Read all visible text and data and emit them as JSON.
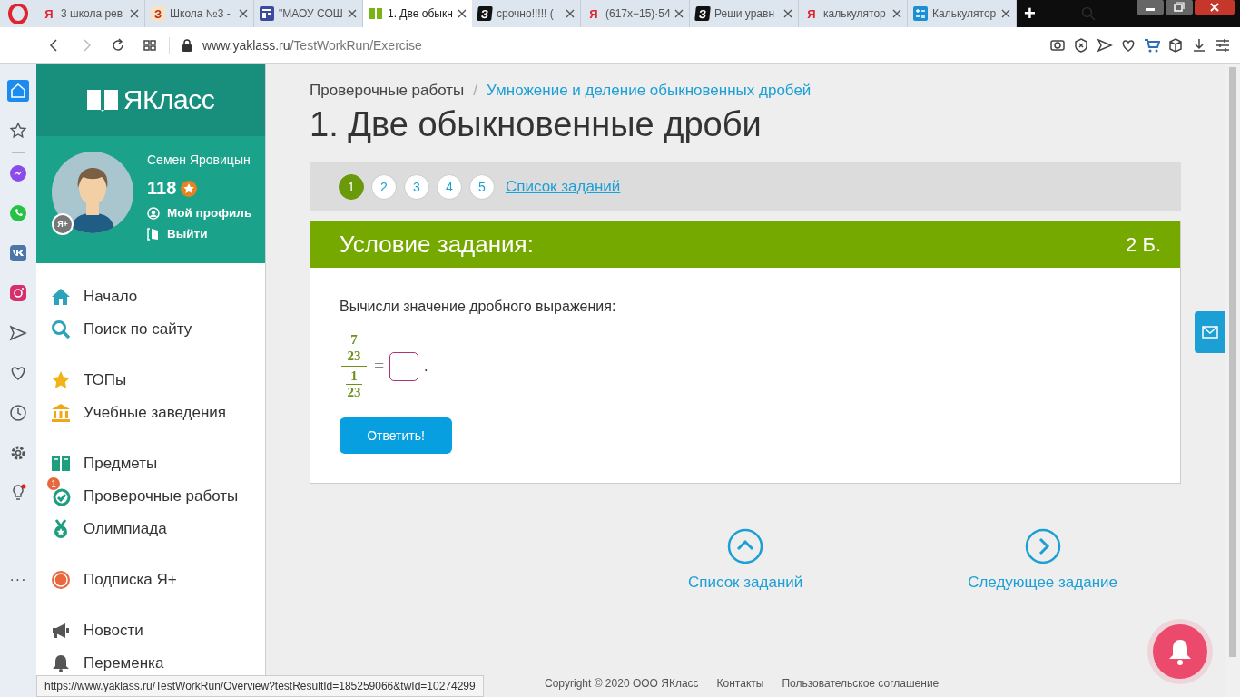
{
  "browser": {
    "tabs": [
      {
        "title": "3 школа рев",
        "kind": "yandex",
        "icon_letter": "Я",
        "selected": false
      },
      {
        "title": "Школа №3 -",
        "kind": "orange-letter",
        "icon_letter": "З",
        "selected": false
      },
      {
        "title": "\"МАОУ СОШ",
        "kind": "site",
        "selected": false
      },
      {
        "title": "1. Две обыкн",
        "kind": "book",
        "selected": true
      },
      {
        "title": "срочно!!!!! (",
        "kind": "black-letter",
        "icon_letter": "З",
        "selected": false
      },
      {
        "title": "(617x−15)·54",
        "kind": "yandex",
        "icon_letter": "Я",
        "selected": false
      },
      {
        "title": "Реши уравн",
        "kind": "black-letter",
        "icon_letter": "З",
        "selected": false
      },
      {
        "title": "калькулятор",
        "kind": "yandex",
        "icon_letter": "Я",
        "selected": false
      },
      {
        "title": "Калькулятор",
        "kind": "calc",
        "selected": false
      }
    ],
    "new_tab": "+",
    "url": {
      "host": "www.yaklass.ru",
      "path": "/TestWorkRun/Exercise"
    },
    "side_icons": [
      {
        "kind": "home",
        "selected": true
      },
      {
        "kind": "star",
        "selected": false
      },
      {
        "kind": "messenger",
        "selected": false
      },
      {
        "kind": "whatsapp",
        "selected": false
      },
      {
        "kind": "vk",
        "selected": false
      },
      {
        "kind": "instagram",
        "selected": false
      },
      {
        "kind": "send",
        "selected": false
      },
      {
        "kind": "heart",
        "selected": false
      },
      {
        "kind": "clock",
        "selected": false
      },
      {
        "kind": "settings",
        "selected": false
      },
      {
        "kind": "bulb",
        "selected": false
      }
    ],
    "more": "···",
    "status_url": "https://www.yaklass.ru/TestWorkRun/Overview?testResultId=185259066&twId=10274299"
  },
  "site": {
    "logo": "ЯКласс",
    "profile": {
      "name": "Семен Яровицын",
      "points": "118",
      "badge": "Я+",
      "links": [
        {
          "kind": "user",
          "label": "Мой профиль"
        },
        {
          "kind": "exit",
          "label": "Выйти"
        }
      ]
    },
    "nav": [
      [
        {
          "kind": "home",
          "label": "Начало"
        },
        {
          "kind": "search",
          "label": "Поиск по сайту"
        }
      ],
      [
        {
          "kind": "star",
          "label": "ТОПы"
        },
        {
          "kind": "school",
          "label": "Учебные заведения"
        }
      ],
      [
        {
          "kind": "book",
          "label": "Предметы"
        },
        {
          "kind": "check",
          "label": "Проверочные работы",
          "count": "1"
        },
        {
          "kind": "medal",
          "label": "Олимпиада"
        }
      ],
      [
        {
          "kind": "plus",
          "label": "Подписка Я+"
        }
      ],
      [
        {
          "kind": "news",
          "label": "Новости"
        },
        {
          "kind": "bell",
          "label": "Переменка"
        }
      ]
    ],
    "breadcrumb": {
      "items": [
        "Проверочные работы",
        "Умножение и деление обыкновенных дробей"
      ],
      "separator": "/"
    },
    "title": "1. Две обыкновенные дроби",
    "pager": {
      "pages": [
        {
          "label": "1",
          "selected": true
        },
        {
          "label": "2",
          "selected": false
        },
        {
          "label": "3",
          "selected": false
        },
        {
          "label": "4",
          "selected": false
        },
        {
          "label": "5",
          "selected": false
        }
      ],
      "list_link": "Список заданий"
    },
    "task": {
      "heading": "Условие задания:",
      "score": "2 Б.",
      "question": "Вычисли значение дробного выражения:",
      "expression": {
        "top": {
          "num": "7",
          "den": "23"
        },
        "bottom": {
          "num": "1",
          "den": "23"
        },
        "equals": "=",
        "end": "."
      },
      "answer_button": "Ответить!"
    },
    "bottom_nav": [
      {
        "kind": "up",
        "label": "Список заданий"
      },
      {
        "kind": "right",
        "label": "Следующее задание"
      }
    ],
    "footer": [
      "Copyright © 2020 ООО ЯКласс",
      "Контакты",
      "Пользовательское соглашение"
    ]
  }
}
